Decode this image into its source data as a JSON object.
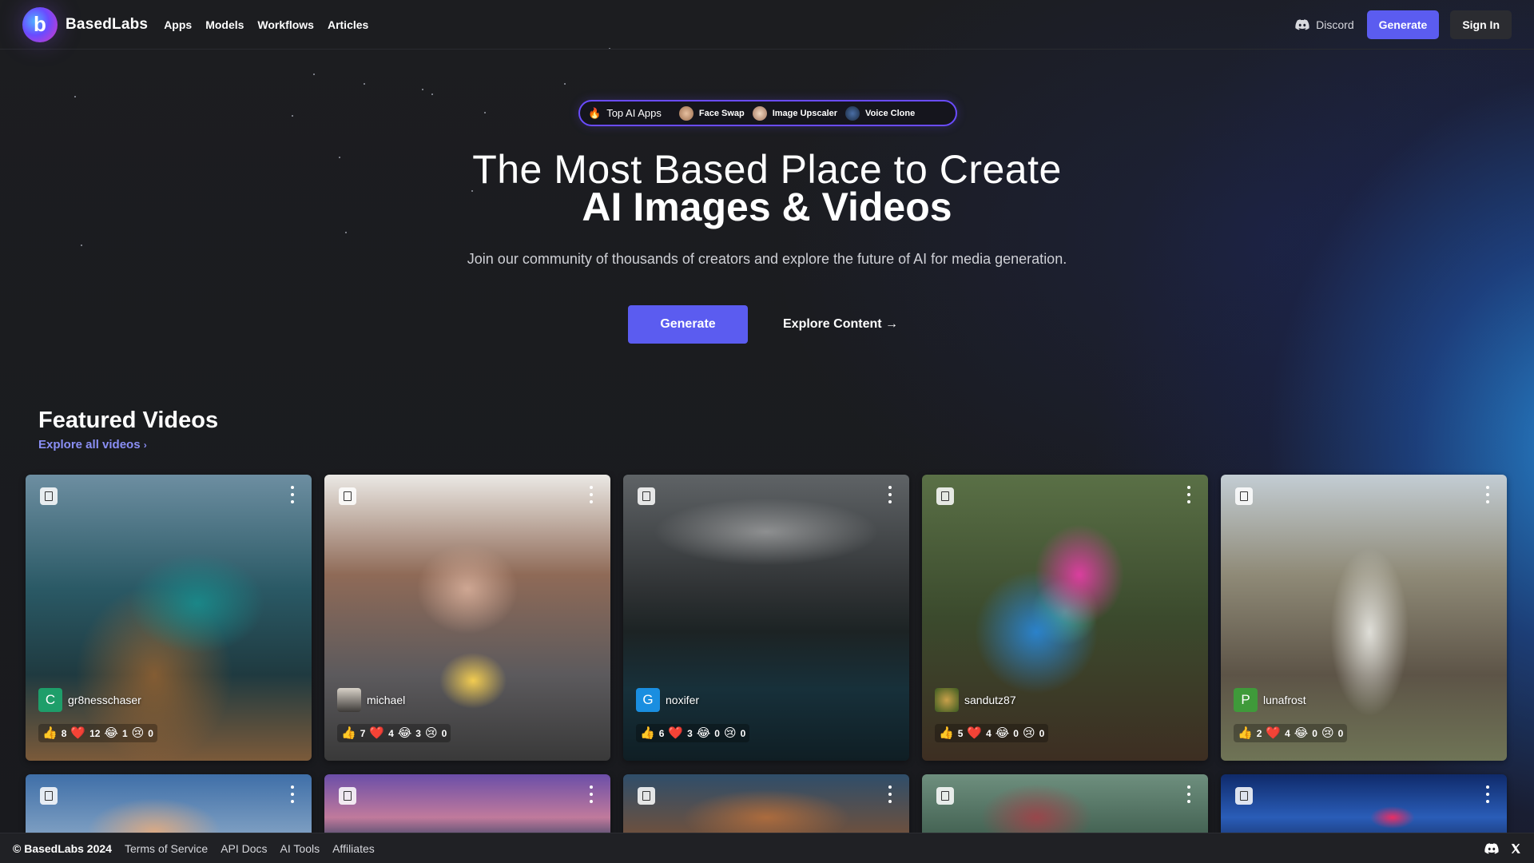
{
  "header": {
    "brand": "BasedLabs",
    "logo_letter": "b",
    "nav": [
      "Apps",
      "Models",
      "Workflows",
      "Articles"
    ],
    "discord_label": "Discord",
    "generate_label": "Generate",
    "signin_label": "Sign In"
  },
  "pill": {
    "top_label": "Top AI Apps",
    "apps": [
      "Face Swap",
      "Image Upscaler",
      "Voice Clone"
    ]
  },
  "hero": {
    "line1": "The Most Based Place to Create",
    "line2": "AI Images & Videos",
    "subtitle": "Join our community of thousands of creators and explore the future of AI for media generation.",
    "generate_label": "Generate",
    "explore_label": "Explore Content →"
  },
  "featured": {
    "title": "Featured Videos",
    "link_label": "Explore all videos"
  },
  "cards": [
    {
      "user": "gr8nesschaser",
      "avatar_letter": "C",
      "avatar_color": "#1e9e6a",
      "likes": "8",
      "hearts": "12",
      "laughs": "1",
      "sads": "0"
    },
    {
      "user": "michael",
      "avatar_letter": "",
      "avatar_color": "#6f6a64",
      "likes": "7",
      "hearts": "4",
      "laughs": "3",
      "sads": "0"
    },
    {
      "user": "noxifer",
      "avatar_letter": "G",
      "avatar_color": "#1a8ee0",
      "likes": "6",
      "hearts": "3",
      "laughs": "0",
      "sads": "0"
    },
    {
      "user": "sandutz87",
      "avatar_letter": "",
      "avatar_color": "#4d7a2b",
      "likes": "5",
      "hearts": "4",
      "laughs": "0",
      "sads": "0"
    },
    {
      "user": "lunafrost",
      "avatar_letter": "P",
      "avatar_color": "#3f9a3a",
      "likes": "2",
      "hearts": "4",
      "laughs": "0",
      "sads": "0"
    }
  ],
  "footer": {
    "copyright": "© BasedLabs 2024",
    "links": [
      "Terms of Service",
      "API Docs",
      "AI Tools",
      "Affiliates"
    ]
  },
  "colors": {
    "accent": "#5b5cf0",
    "link": "#8a8ff5",
    "background": "#1b1c1f"
  }
}
